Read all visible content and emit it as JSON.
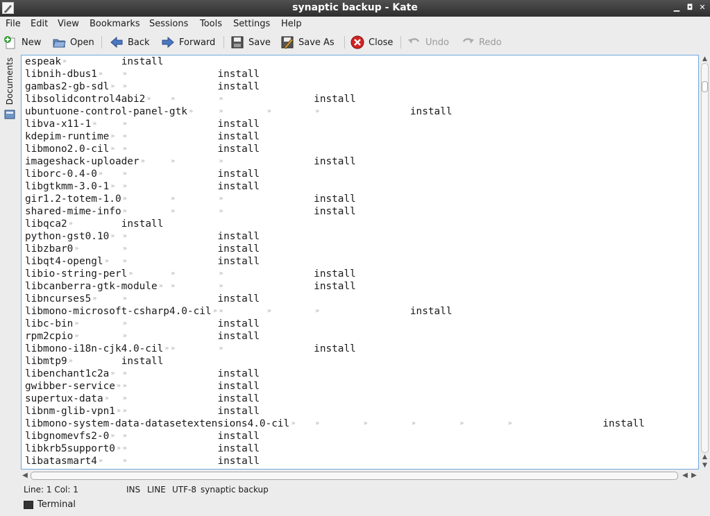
{
  "window": {
    "title": "synaptic backup - Kate",
    "minimize": "▁",
    "maximize": "◘",
    "close": "✕"
  },
  "menu": [
    "File",
    "Edit",
    "View",
    "Bookmarks",
    "Sessions",
    "Tools",
    "Settings",
    "Help"
  ],
  "toolbar": {
    "new": "New",
    "open": "Open",
    "back": "Back",
    "forward": "Forward",
    "save": "Save",
    "save_as": "Save As",
    "close": "Close",
    "undo": "Undo",
    "redo": "Redo"
  },
  "sidebar": {
    "documents_tab": "Documents"
  },
  "editor": {
    "status_word": "install",
    "lines": [
      {
        "pkg": "espeak",
        "col": 1
      },
      {
        "pkg": "libnih-dbus1",
        "col": 2
      },
      {
        "pkg": "gambas2-gb-sdl",
        "col": 2
      },
      {
        "pkg": "libsolidcontrol4abi2",
        "col": 3
      },
      {
        "pkg": "ubuntuone-control-panel-gtk",
        "col": 4
      },
      {
        "pkg": "libva-x11-1",
        "col": 2
      },
      {
        "pkg": "kdepim-runtime",
        "col": 2
      },
      {
        "pkg": "libmono2.0-cil",
        "col": 2
      },
      {
        "pkg": "imageshack-uploader",
        "col": 3
      },
      {
        "pkg": "liborc-0.4-0",
        "col": 2
      },
      {
        "pkg": "libgtkmm-3.0-1",
        "col": 2
      },
      {
        "pkg": "gir1.2-totem-1.0",
        "col": 3
      },
      {
        "pkg": "shared-mime-info",
        "col": 3
      },
      {
        "pkg": "libqca2",
        "col": 1
      },
      {
        "pkg": "python-gst0.10",
        "col": 2
      },
      {
        "pkg": "libzbar0",
        "col": 2
      },
      {
        "pkg": "libqt4-opengl",
        "col": 2
      },
      {
        "pkg": "libio-string-perl",
        "col": 3
      },
      {
        "pkg": "libcanberra-gtk-module",
        "col": 3
      },
      {
        "pkg": "libncurses5",
        "col": 2
      },
      {
        "pkg": "libmono-microsoft-csharp4.0-cil",
        "col": 4
      },
      {
        "pkg": "libc-bin",
        "col": 2
      },
      {
        "pkg": "rpm2cpio",
        "col": 2
      },
      {
        "pkg": "libmono-i18n-cjk4.0-cil",
        "col": 3
      },
      {
        "pkg": "libmtp9",
        "col": 1
      },
      {
        "pkg": "libenchant1c2a",
        "col": 2
      },
      {
        "pkg": "gwibber-service",
        "col": 2
      },
      {
        "pkg": "supertux-data",
        "col": 2
      },
      {
        "pkg": "libnm-glib-vpn1",
        "col": 2
      },
      {
        "pkg": "libmono-system-data-datasetextensions4.0-cil",
        "col": 6
      },
      {
        "pkg": "libgnomevfs2-0",
        "col": 2
      },
      {
        "pkg": "libkrb5support0",
        "col": 2
      },
      {
        "pkg": "libatasmart4",
        "col": 2
      }
    ]
  },
  "statusbar": {
    "position": "Line: 1 Col: 1",
    "mode": "INS",
    "selection": "LINE",
    "encoding": "UTF-8",
    "document": "synaptic backup"
  },
  "bottom": {
    "terminal": "Terminal"
  }
}
